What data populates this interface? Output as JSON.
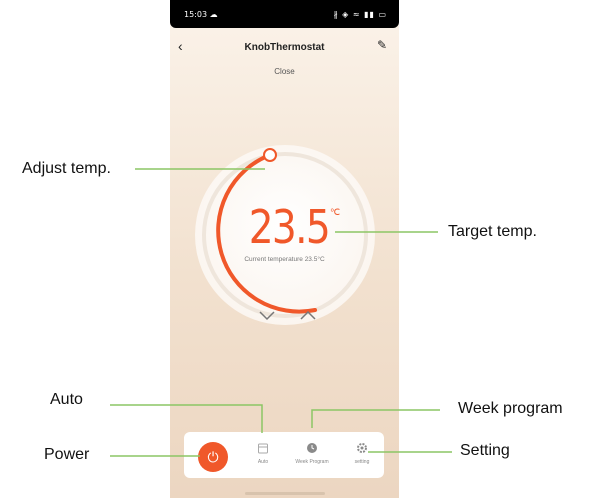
{
  "status_bar": {
    "time": "15:03 ☁",
    "icons": "∦ ◈ ≈ ▮▮ ▭"
  },
  "header": {
    "title": "KnobThermostat",
    "subtitle": "Close",
    "back_icon": "back-chevron-icon",
    "edit_icon": "edit-pencil-icon"
  },
  "thermostat": {
    "target_value": "23.5",
    "unit": "℃",
    "current_label": "Current temperature 23.5°C",
    "accent_color": "#f0582a"
  },
  "bottom_bar": {
    "items": [
      {
        "label": "Auto",
        "icon": "calendar-icon"
      },
      {
        "label": "Week Program",
        "icon": "clock-icon"
      },
      {
        "label": "setting",
        "icon": "gear-icon"
      }
    ],
    "power_icon": "power-icon"
  },
  "annotations": {
    "adjust_temp": "Adjust temp.",
    "target_temp": "Target temp.",
    "auto": "Auto",
    "power": "Power",
    "week_program": "Week program",
    "setting": "Setting",
    "line_color": "#8cc665"
  }
}
